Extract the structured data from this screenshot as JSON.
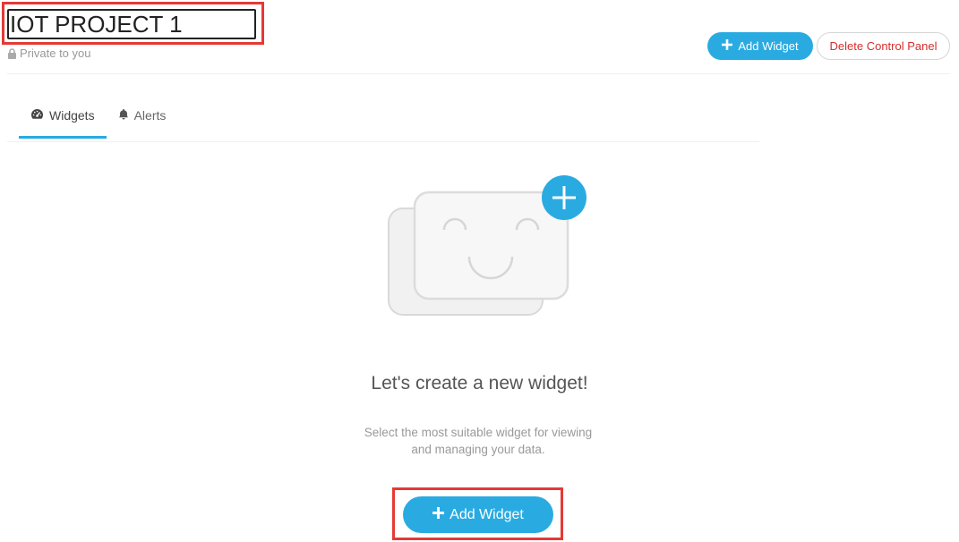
{
  "header": {
    "project_title": "IOT PROJECT 1",
    "privacy_text": "Private to you",
    "add_widget_label": "Add Widget",
    "delete_panel_label": "Delete Control Panel"
  },
  "tabs": [
    {
      "label": "Widgets",
      "icon": "dashboard-gauge-icon",
      "active": true
    },
    {
      "label": "Alerts",
      "icon": "bell-icon",
      "active": false
    }
  ],
  "empty_state": {
    "title": "Let's create a new widget!",
    "subtitle_line1": "Select the most suitable widget for viewing",
    "subtitle_line2": "and managing your data.",
    "add_widget_label": "Add Widget",
    "illustration_icon": "smiling-widget-card-plus-icon"
  },
  "colors": {
    "accent": "#29abe2",
    "danger": "#d32f2f",
    "highlight": "#e53935"
  }
}
